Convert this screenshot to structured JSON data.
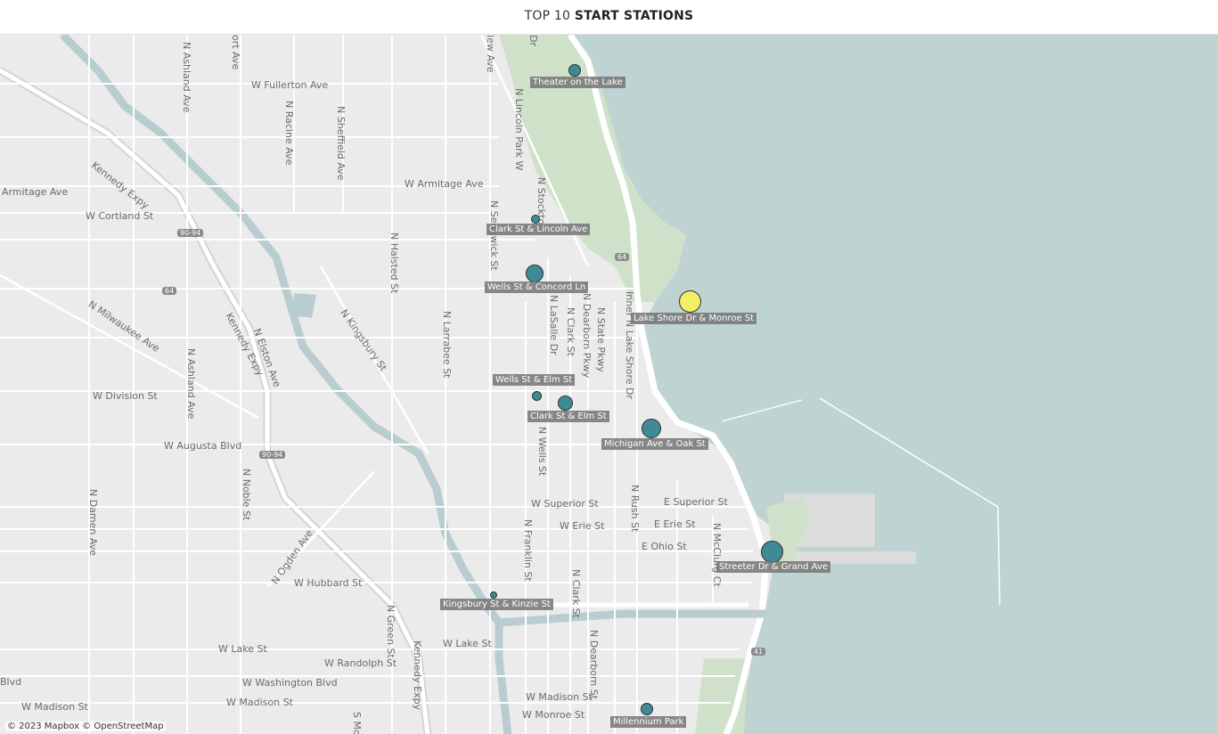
{
  "title": {
    "prefix": "TOP 10",
    "bold": "START STATIONS"
  },
  "colors": {
    "water": "#c0d3d3",
    "land": "#ebebeb",
    "park": "#cfe2c9",
    "station_fill": "#3e8b95",
    "highlight_fill": "#f1f065",
    "label_bg": "#7a7a7a"
  },
  "stations": [
    {
      "name": "Theater on the Lake",
      "highlight": false,
      "rank": "small"
    },
    {
      "name": "Clark St & Lincoln Ave",
      "highlight": false,
      "rank": "tiny"
    },
    {
      "name": "Wells St & Concord Ln",
      "highlight": false,
      "rank": "large"
    },
    {
      "name": "Lake Shore Dr & Monroe St",
      "highlight": true,
      "rank": "largest"
    },
    {
      "name": "Wells St & Elm St",
      "highlight": false,
      "rank": "tiny"
    },
    {
      "name": "Clark St & Elm St",
      "highlight": false,
      "rank": "medium"
    },
    {
      "name": "Michigan Ave & Oak St",
      "highlight": false,
      "rank": "large"
    },
    {
      "name": "Streeter Dr & Grand Ave",
      "highlight": false,
      "rank": "largest"
    },
    {
      "name": "Kingsbury St & Kinzie St",
      "highlight": false,
      "rank": "tiny"
    },
    {
      "name": "Millennium Park",
      "highlight": false,
      "rank": "small"
    }
  ],
  "streets": {
    "fullerton": "W Fullerton Ave",
    "ashland_top": "N Ashland Ave",
    "racine": "N Racine Ave",
    "sheffield": "N Sheffield Ave",
    "kennedy1": "Kennedy Expy",
    "armitage_w": "Armitage Ave",
    "armitage": "W Armitage Ave",
    "cortland": "W Cortland St",
    "lincoln_park_w": "N Lincoln Park W",
    "stockton": "N Stockton",
    "sedgwick": "N Sedgwick St",
    "halsted": "N Halsted St",
    "milwaukee": "N Milwaukee Ave",
    "kennedy2": "Kennedy Expy",
    "elston": "N Elston Ave",
    "kingsbury": "N Kingsbury St",
    "larrabee": "N Larrabee St",
    "lasalle": "N LaSalle Dr",
    "clark": "N Clark St",
    "dearborn": "N Dearborn Pkwy",
    "state": "N State Pkwy",
    "inner_lsd": "Inner N Lake Shore Dr",
    "ashland_mid": "N Ashland Ave",
    "division": "W Division St",
    "augusta": "W Augusta Blvd",
    "noble": "N Noble St",
    "wells": "N Wells St",
    "damen": "N Damen Ave",
    "superior_w": "W Superior St",
    "superior_e": "E Superior St",
    "erie_w": "W Erie St",
    "erie_e": "E Erie St",
    "ohio_e": "E Ohio St",
    "rush": "N Rush St",
    "mcclurg": "N McClurg Ct",
    "franklin": "N Franklin St",
    "ogden": "N Ogden Ave",
    "hubbard": "W Hubbard St",
    "clark_s": "N Clark St",
    "green": "N Green St",
    "kennedy3": "Kennedy Expy",
    "lake": "W Lake St",
    "dearborn_s": "N Dearborn St",
    "randolph": "W Randolph St",
    "washington": "W Washington Blvd",
    "madison_w": "W Madison St",
    "madison_w2": "W Madison St",
    "madison_c": "W Madison St",
    "monroe": "W Monroe St",
    "blvd": "Blvd",
    "smo": "S Mo",
    "court_ave": "ort Ave",
    "view_ave": "iew Ave",
    "dr_top": "Dr"
  },
  "shields": [
    "90-94",
    "64",
    "64",
    "90-94",
    "41"
  ],
  "attribution": "© 2023 Mapbox © OpenStreetMap"
}
